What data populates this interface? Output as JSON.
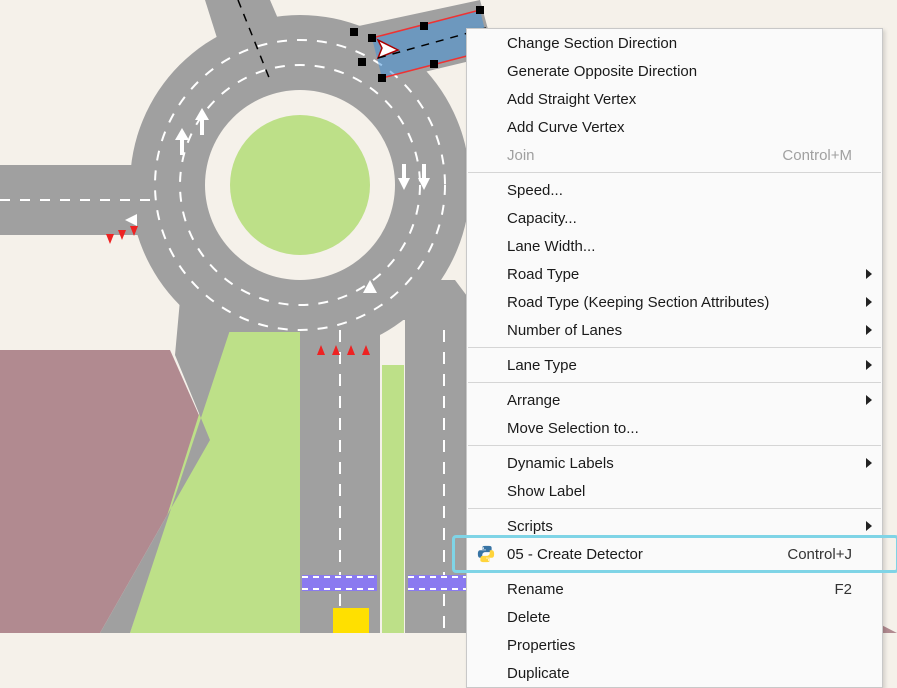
{
  "menu": {
    "items": [
      {
        "label": "Change Section Direction"
      },
      {
        "label": "Generate Opposite Direction"
      },
      {
        "label": "Add Straight Vertex"
      },
      {
        "label": "Add Curve Vertex"
      },
      {
        "label": "Join",
        "shortcut": "Control+M",
        "disabled": true
      },
      {
        "sep": true
      },
      {
        "label": "Speed..."
      },
      {
        "label": "Capacity..."
      },
      {
        "label": "Lane Width..."
      },
      {
        "label": "Road Type",
        "submenu": true
      },
      {
        "label": "Road Type (Keeping Section Attributes)",
        "submenu": true
      },
      {
        "label": "Number of Lanes",
        "submenu": true
      },
      {
        "sep": true
      },
      {
        "label": "Lane Type",
        "submenu": true
      },
      {
        "sep": true
      },
      {
        "label": "Arrange",
        "submenu": true
      },
      {
        "label": "Move Selection to..."
      },
      {
        "sep": true
      },
      {
        "label": "Dynamic Labels",
        "submenu": true
      },
      {
        "label": "Show Label"
      },
      {
        "sep": true
      },
      {
        "label": "Scripts",
        "submenu": true
      },
      {
        "label": "05 - Create Detector",
        "shortcut": "Control+J",
        "icon": "python",
        "highlight": true
      },
      {
        "sep": true
      },
      {
        "label": "Rename",
        "shortcut": "F2"
      },
      {
        "label": "Delete"
      },
      {
        "label": "Properties"
      },
      {
        "label": "Duplicate"
      }
    ]
  },
  "map": {
    "road_color": "#a0a0a0",
    "lane_dash": "#ffffff",
    "grass": "#bde088",
    "building": "#b18a90",
    "bg": "#f5f1ea",
    "selection": "#2f8fe0",
    "selection_outline": "#e33",
    "detector_purple": "#8a7af0",
    "detector_yellow": "#ffe000"
  }
}
